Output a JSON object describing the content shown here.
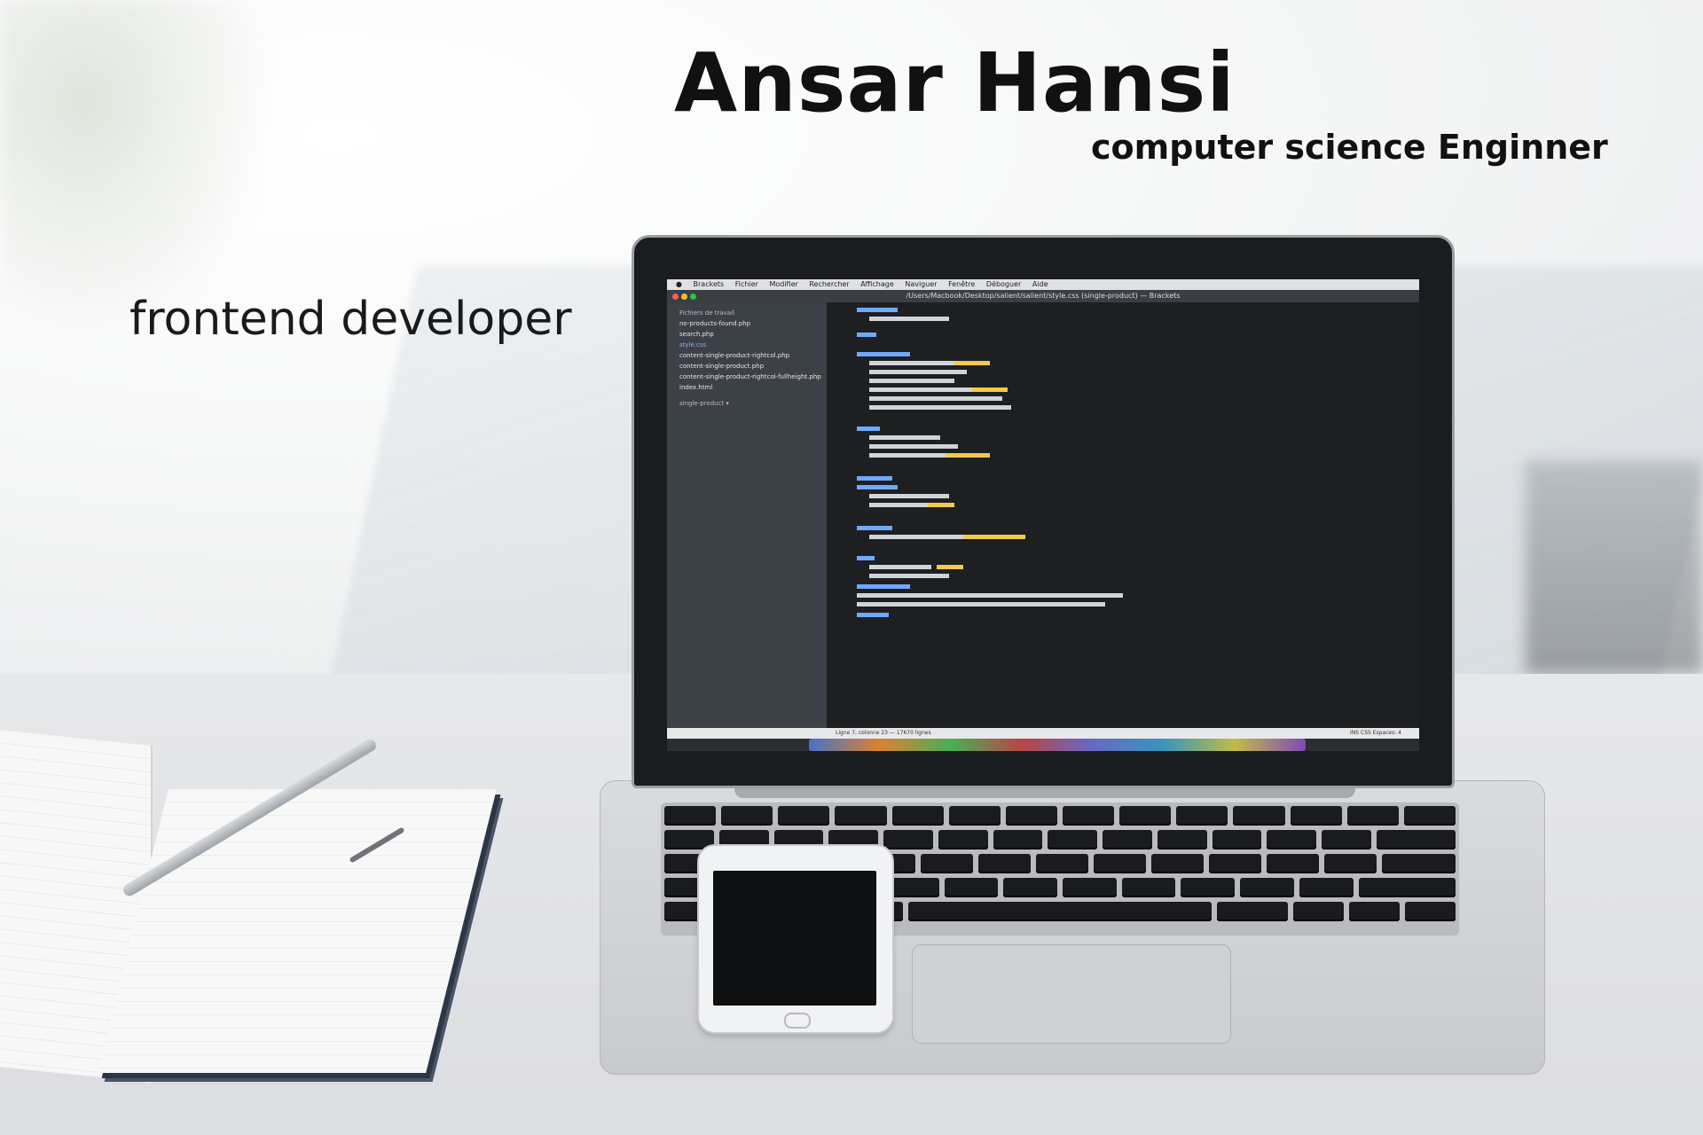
{
  "heading": {
    "name": "Ansar Hansi",
    "subtitle": "computer science Enginner",
    "role": "frontend developer"
  },
  "laptop_screen": {
    "menubar": [
      "Brackets",
      "Fichier",
      "Modifier",
      "Rechercher",
      "Affichage",
      "Naviguer",
      "Fenêtre",
      "Déboguer",
      "Aide"
    ],
    "window_title": "/Users/Macbook/Desktop/salient/salient/style.css (single-product) — Brackets",
    "sidebar_header": "Fichiers de travail",
    "files": [
      "no-products-found.php",
      "search.php",
      "style.css",
      "content-single-product-rightcol.php",
      "content-single-product.php",
      "content-single-product-rightcol-fullheight.php",
      "index.html"
    ],
    "project": "single-product ▾",
    "status_left": "Ligne 7, colonne 23 — 17670 lignes",
    "status_right": "INS  CSS  Espaces: 4"
  },
  "colors": {
    "title": "#111111",
    "editor_bg": "#1d1f21",
    "selector": "#6ea9ff",
    "value": "#f2c94c"
  }
}
